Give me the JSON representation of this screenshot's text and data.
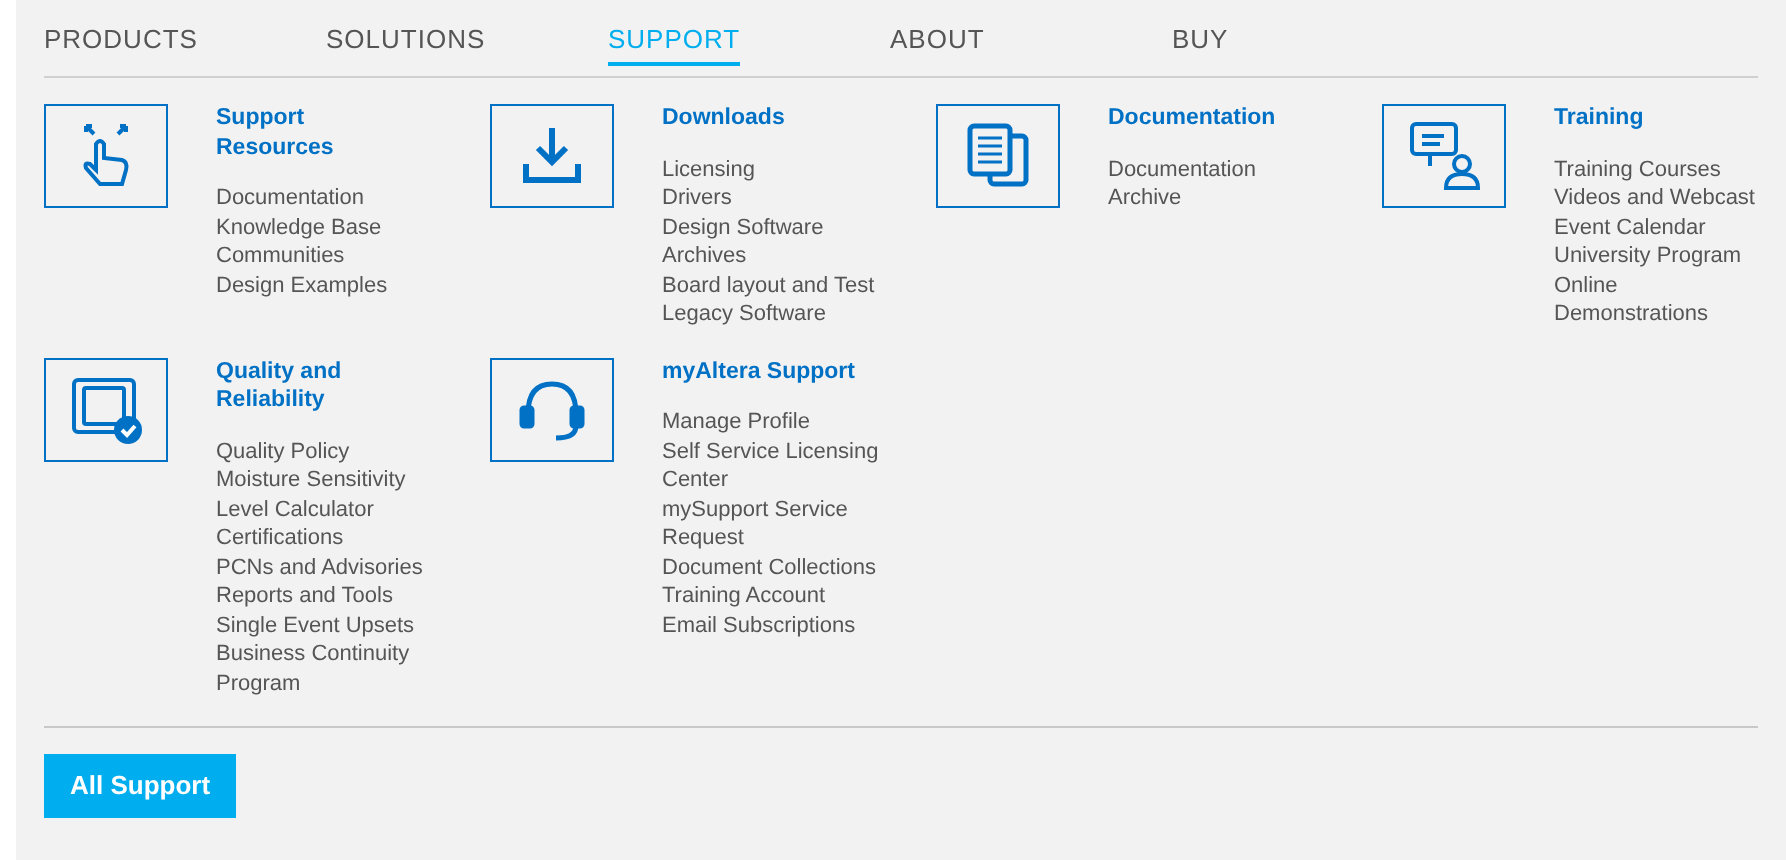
{
  "nav": [
    {
      "label": "PRODUCTS",
      "selected": false
    },
    {
      "label": "SOLUTIONS",
      "selected": false
    },
    {
      "label": "SUPPORT",
      "selected": true
    },
    {
      "label": "ABOUT",
      "selected": false
    },
    {
      "label": "BUY",
      "selected": false
    }
  ],
  "sections": [
    {
      "kind": "hand",
      "title": "Support Resources",
      "links": [
        "Documentation",
        "Knowledge Base",
        "Communities",
        "Design Examples"
      ]
    },
    {
      "kind": "download",
      "title": "Downloads",
      "links": [
        "Licensing",
        "Drivers",
        "Design Software",
        "Archives",
        "Board layout and Test",
        "Legacy Software"
      ]
    },
    {
      "kind": "documents",
      "title": "Documentation",
      "links": [
        "Documentation",
        "Archive"
      ]
    },
    {
      "kind": "presenter",
      "title": "Training",
      "links": [
        "Training Courses",
        "Videos and Webcast",
        "Event Calendar",
        "University Program",
        "Online",
        "Demonstrations"
      ]
    },
    {
      "kind": "board",
      "title": "Quality and Reliability",
      "links": [
        "Quality Policy",
        "Moisture Sensitivity",
        "Level Calculator",
        "Certifications",
        "PCNs and Advisories",
        "Reports and Tools",
        "Single Event Upsets",
        "Business Continuity",
        "Program"
      ]
    },
    {
      "kind": "headset",
      "title": "myAltera Support",
      "links": [
        "Manage Profile",
        "Self Service Licensing",
        "Center",
        "mySupport Service",
        "Request",
        "Document Collections",
        "Training Account",
        "Email Subscriptions"
      ]
    }
  ],
  "button": "All Support"
}
